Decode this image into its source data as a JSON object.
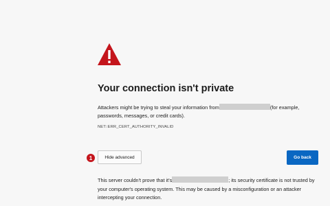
{
  "page": {
    "title": "Your connection isn't private",
    "description_before": "Attackers might be trying to steal your information from",
    "description_after": "(for example, passwords, messages, or credit cards).",
    "error_code": "NET::ERR_CERT_AUTHORITY_INVALID",
    "details_before": "This server couldn't prove that it's",
    "details_after": "; its security certificate is not trusted by your computer's operating system. This may be caused by a misconfiguration or an attacker intercepting your connection."
  },
  "buttons": {
    "hide_advanced_label": "Hide advanced",
    "go_back_label": "Go back"
  },
  "annotation": {
    "badge_number": "1"
  },
  "icons": {
    "warning": "warning-triangle-icon"
  },
  "colors": {
    "warning_red": "#c4151c",
    "primary_blue": "#0a67c2",
    "background": "#f7f7f7"
  }
}
